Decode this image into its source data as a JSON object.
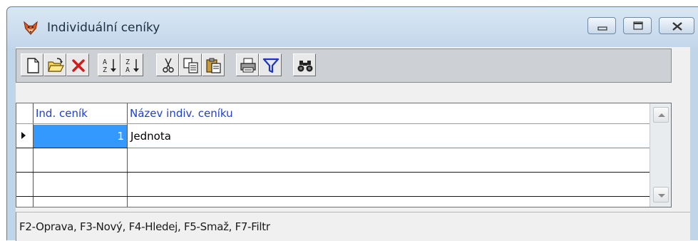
{
  "window": {
    "title": "Individuální ceníky",
    "app_icon": "fox-head-icon",
    "controls": [
      "minimize-icon",
      "maximize-icon",
      "close-icon"
    ]
  },
  "toolbar": {
    "groups": [
      [
        "new-document-icon",
        "open-folder-icon",
        "delete-icon"
      ],
      [
        "sort-ascending-icon",
        "sort-descending-icon"
      ],
      [
        "cut-icon",
        "copy-icon",
        "paste-icon"
      ],
      [
        "print-icon",
        "filter-icon"
      ],
      [
        "find-binoculars-icon"
      ]
    ]
  },
  "grid": {
    "columns": [
      "Ind. ceník",
      "Název indiv. ceníku"
    ],
    "rows": [
      {
        "id": "1",
        "name": "Jednota"
      }
    ]
  },
  "status_bar": {
    "text": "F2-Oprava, F3-Nový, F4-Hledej, F5-Smaž, F7-Filtr"
  },
  "colors": {
    "header_text": "#1f3fd0",
    "selected_cell": "#3399ff",
    "title_bar": "#c3d6ea",
    "delete_red": "#d11a1a",
    "filter_blue": "#1d34c8"
  }
}
